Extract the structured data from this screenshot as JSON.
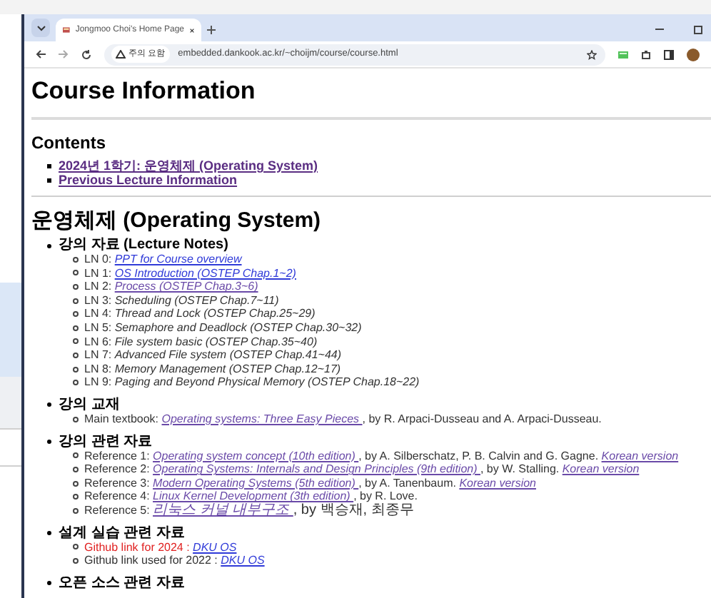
{
  "browser": {
    "tab_title": "Jongmoo Choi's Home Page",
    "security_label": "주의 요함",
    "url": "embedded.dankook.ac.kr/~choijm/course/course.html"
  },
  "page": {
    "title": "Course Information",
    "contents_heading": "Contents",
    "contents": [
      {
        "text": "2024년 1학기: 운영체제 (Operating System)",
        "visited": true
      },
      {
        "text": "Previous Lecture Information",
        "visited": true
      }
    ],
    "section_title": "운영체제 (Operating System)",
    "groups": [
      {
        "heading": "강의 자료 (Lecture Notes)",
        "items": [
          {
            "parts": [
              {
                "kind": "text",
                "text": "LN 0: "
              },
              {
                "kind": "link",
                "text": "PPT for Course overview",
                "visited": false
              }
            ]
          },
          {
            "parts": [
              {
                "kind": "text",
                "text": "LN 1: "
              },
              {
                "kind": "link",
                "text": "OS Introduction (OSTEP Chap.1~2)",
                "visited": false
              }
            ]
          },
          {
            "parts": [
              {
                "kind": "text",
                "text": "LN 2: "
              },
              {
                "kind": "link",
                "text": "Process (OSTEP Chap.3~6)",
                "visited": true
              }
            ]
          },
          {
            "parts": [
              {
                "kind": "text",
                "text": "LN 3: "
              },
              {
                "kind": "italic",
                "text": "Scheduling (OSTEP Chap.7~11)"
              }
            ]
          },
          {
            "parts": [
              {
                "kind": "text",
                "text": "LN 4: "
              },
              {
                "kind": "italic",
                "text": "Thread and Lock (OSTEP Chap.25~29)"
              }
            ]
          },
          {
            "parts": [
              {
                "kind": "text",
                "text": "LN 5: "
              },
              {
                "kind": "italic",
                "text": "Semaphore and Deadlock (OSTEP Chap.30~32)"
              }
            ]
          },
          {
            "parts": [
              {
                "kind": "text",
                "text": "LN 6: "
              },
              {
                "kind": "italic",
                "text": "File system basic (OSTEP Chap.35~40)"
              }
            ]
          },
          {
            "parts": [
              {
                "kind": "text",
                "text": "LN 7: "
              },
              {
                "kind": "italic",
                "text": "Advanced File system (OSTEP Chap.41~44)"
              }
            ]
          },
          {
            "parts": [
              {
                "kind": "text",
                "text": "LN 8: "
              },
              {
                "kind": "italic",
                "text": "Memory Management (OSTEP Chap.12~17)"
              }
            ]
          },
          {
            "parts": [
              {
                "kind": "text",
                "text": "LN 9: "
              },
              {
                "kind": "italic",
                "text": "Paging and Beyond Physical Memory (OSTEP Chap.18~22)"
              }
            ]
          }
        ]
      },
      {
        "heading": "강의 교재",
        "items": [
          {
            "parts": [
              {
                "kind": "text",
                "text": "Main textbook: "
              },
              {
                "kind": "link",
                "text": "Operating systems: Three Easy Pieces ",
                "visited": true
              },
              {
                "kind": "text",
                "text": ", by R. Arpaci-Dusseau and A. Arpaci-Dusseau."
              }
            ]
          }
        ]
      },
      {
        "heading": "강의 관련 자료",
        "items": [
          {
            "parts": [
              {
                "kind": "text",
                "text": "Reference 1: "
              },
              {
                "kind": "link",
                "text": "Operating system concept (10th edition) ",
                "visited": true
              },
              {
                "kind": "text",
                "text": ", by A. Silberschatz, P. B. Calvin and G. Gagne. "
              },
              {
                "kind": "link",
                "text": "Korean version",
                "visited": true
              }
            ]
          },
          {
            "parts": [
              {
                "kind": "text",
                "text": "Reference 2: "
              },
              {
                "kind": "link",
                "text": "Operating Systems: Internals and Design Principles (9th edition) ",
                "visited": true
              },
              {
                "kind": "text",
                "text": ", by W. Stalling. "
              },
              {
                "kind": "link",
                "text": "Korean version",
                "visited": true
              }
            ]
          },
          {
            "parts": [
              {
                "kind": "text",
                "text": "Reference 3: "
              },
              {
                "kind": "link",
                "text": "Modern Operating Systems (5th edition) ",
                "visited": true
              },
              {
                "kind": "text",
                "text": ", by A. Tanenbaum. "
              },
              {
                "kind": "link",
                "text": "Korean version",
                "visited": true
              }
            ]
          },
          {
            "parts": [
              {
                "kind": "text",
                "text": "Reference 4: "
              },
              {
                "kind": "link",
                "text": "Linux Kernel Development (3th edition) ",
                "visited": true
              },
              {
                "kind": "text",
                "text": ", by R. Love."
              }
            ]
          },
          {
            "parts": [
              {
                "kind": "text",
                "text": "Reference 5: "
              },
              {
                "kind": "link",
                "text": "리눅스 커널 내부구조 ",
                "visited": true
              },
              {
                "kind": "text",
                "text": ", by 백승재, 최종무"
              }
            ]
          }
        ]
      },
      {
        "heading": "설계 실습 관련 자료",
        "items": [
          {
            "parts": [
              {
                "kind": "alert",
                "text": "Github link for 2024 : "
              },
              {
                "kind": "link",
                "text": "DKU OS",
                "visited": false
              }
            ]
          },
          {
            "parts": [
              {
                "kind": "text",
                "text": "Github link used for 2022 : "
              },
              {
                "kind": "link",
                "text": "DKU OS",
                "visited": false
              }
            ]
          }
        ]
      },
      {
        "heading": "오픈 소스 관련 자료"
      }
    ]
  }
}
